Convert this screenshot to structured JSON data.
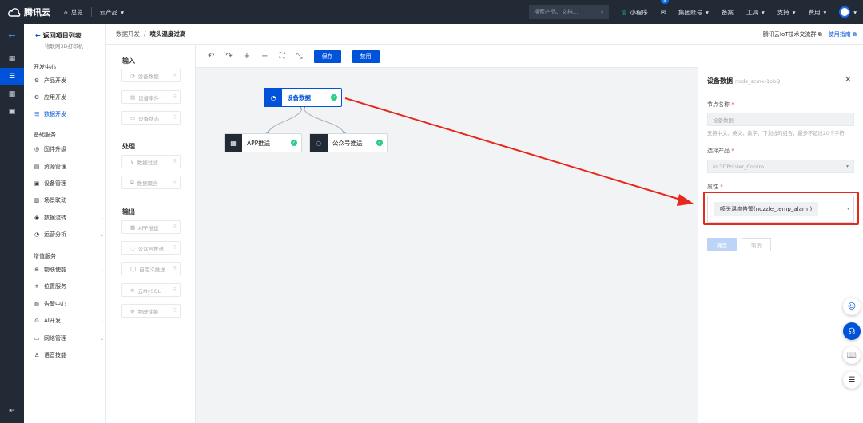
{
  "topbar": {
    "brand": "腾讯云",
    "overview": "总览",
    "products": "云产品",
    "search_placeholder": "搜索产品、文档...",
    "mini_program": "小程序",
    "mail_count": "9",
    "account": "集团账号",
    "billing": "备案",
    "tools": "工具",
    "support": "支持",
    "cost": "费用"
  },
  "sidebar": {
    "back": "返回项目列表",
    "project": "物联网3D打印机",
    "section1": "开发中心",
    "dev": [
      "产品开发",
      "应用开发",
      "数据开发"
    ],
    "section2": "基础服务",
    "basic": [
      "固件升级",
      "资源管理",
      "设备管理",
      "场景联动",
      "数据流转",
      "运营分析"
    ],
    "section3": "增值服务",
    "value": [
      "物联使能",
      "位置服务",
      "告警中心",
      "AI开发",
      "网络管理",
      "语音技能"
    ]
  },
  "header": {
    "crumb1": "数据开发",
    "sep": "/",
    "crumb2": "喷头温度过高",
    "community": "腾讯云IoT技术交流群",
    "guide": "使用指南"
  },
  "palette": {
    "input_title": "输入",
    "inputs": [
      "设备数据",
      "设备事件",
      "设备状态"
    ],
    "process_title": "处理",
    "process": [
      "数据过滤",
      "数据聚合"
    ],
    "output_title": "输出",
    "outputs": [
      "APP推送",
      "公众号推送",
      "自定义推送",
      "云MySQL",
      "物联使能"
    ]
  },
  "toolbar": {
    "save": "保存",
    "disable": "禁用"
  },
  "nodes": {
    "source": "设备数据",
    "app": "APP推送",
    "wechat": "公众号推送"
  },
  "panel": {
    "title": "设备数据",
    "node_id": "node_scmx-1obQ",
    "name_label": "节点名称",
    "name_value": "设备数据",
    "name_hint": "支持中文、英文、数字、下划线的组合，最多不超过20个字符",
    "product_label": "选择产品",
    "product_value": "iot3DPrinter_Contro",
    "prop_label": "属性",
    "prop_tag": "喷头温度告警(nozzle_temp_alarm)",
    "confirm": "确定",
    "cancel": "取消"
  },
  "colors": {
    "brand_blue": "#0052d9",
    "dark_bg": "#222a35",
    "success_green": "#29cc85",
    "annotation_red": "#e6281f"
  }
}
